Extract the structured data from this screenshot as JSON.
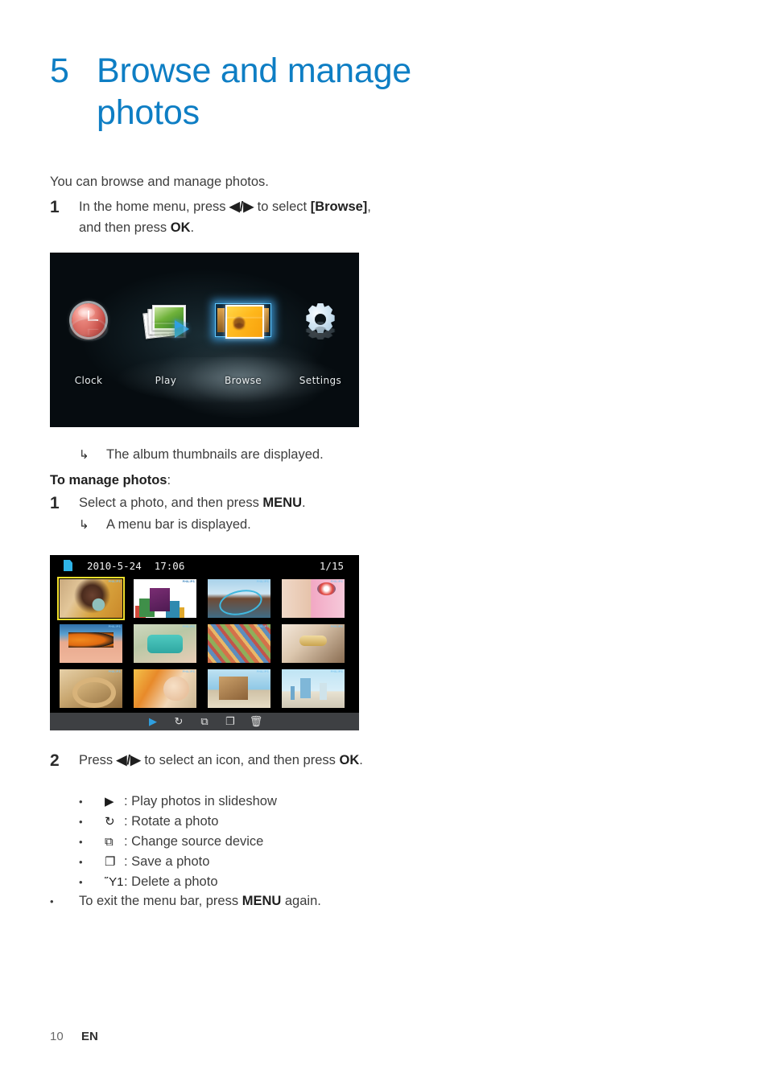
{
  "document": {
    "chapter_number": "5",
    "chapter_title": "Browse and manage photos",
    "intro": "You can browse and manage photos.",
    "footer": {
      "page_number": "10",
      "language": "EN"
    }
  },
  "steps": {
    "step1": {
      "number": "1",
      "text_part1": "In the home menu, press ",
      "nav_glyph": "◀/▶",
      "text_part2": " to select ",
      "bold_target": "[Browse]",
      "text_part3": ", and then press ",
      "bold_key": "OK",
      "text_part4": "."
    },
    "result_album": {
      "arrow": "↳",
      "text": "The album thumbnails are displayed."
    },
    "subheading": {
      "bold": "To manage photos",
      "colon": ":"
    },
    "manage_step1": {
      "number": "1",
      "text_part1": "Select a photo, and then press ",
      "bold_key": "MENU",
      "text_part2": "."
    },
    "result_menubar": {
      "arrow": "↳",
      "text": "A menu bar is displayed."
    },
    "step2": {
      "number": "2",
      "text_part1": "Press ",
      "nav_glyph": "◀/▶",
      "text_part2": " to select an icon, and then press ",
      "bold_key": "OK",
      "text_part3": "."
    },
    "icon_list": {
      "bullet": "•",
      "rows": [
        {
          "glyph": "▶",
          "icon_name": "play-icon",
          "text": ": Play photos in slideshow"
        },
        {
          "glyph": "↻",
          "icon_name": "rotate-icon",
          "text": ": Rotate a photo"
        },
        {
          "glyph": "⧉",
          "icon_name": "source-device-icon",
          "text": ": Change source device"
        },
        {
          "glyph": "❐",
          "icon_name": "save-icon",
          "text": ": Save a photo"
        },
        {
          "glyph": "Ὕ1",
          "icon_name": "trash-icon",
          "text": ": Delete a photo"
        }
      ]
    },
    "exit_line": {
      "bullet": "•",
      "text_part1": "To exit the menu bar, press ",
      "bold_key": "MENU",
      "text_part2": " again."
    }
  },
  "screenshot_home_menu": {
    "caption_items": [
      {
        "label": "Clock",
        "icon": "clock-icon",
        "selected": false
      },
      {
        "label": "Play",
        "icon": "play-photos-icon",
        "selected": false
      },
      {
        "label": "Browse",
        "icon": "browse-icon",
        "selected": true
      },
      {
        "label": "Settings",
        "icon": "gear-icon",
        "selected": false
      }
    ]
  },
  "screenshot_thumbnail_grid": {
    "topbar": {
      "file_icon": "file-icon",
      "date": "2010-5-24",
      "time": "17:06",
      "counter": "1/15"
    },
    "watermark": "PHILIPS",
    "thumbnails": [
      [
        {
          "name": "woman-drinking-coffee",
          "selected": true
        },
        {
          "name": "gift-boxes",
          "selected": false
        },
        {
          "name": "pool-party-hula-hoop",
          "selected": false
        },
        {
          "name": "woman-with-puppy",
          "selected": false
        }
      ],
      [
        {
          "name": "butterfly-on-hand",
          "selected": false
        },
        {
          "name": "girl-with-green-gloves",
          "selected": false
        },
        {
          "name": "crowd-festival",
          "selected": false
        },
        {
          "name": "carnival-masks",
          "selected": false
        }
      ],
      [
        {
          "name": "pretzels",
          "selected": false
        },
        {
          "name": "girl-in-sunlight",
          "selected": false
        },
        {
          "name": "stilt-house-beach",
          "selected": false
        },
        {
          "name": "children-on-beach",
          "selected": false
        }
      ]
    ],
    "menubar": [
      {
        "glyph": "▶",
        "name": "slideshow-icon",
        "active": true
      },
      {
        "glyph": "↻",
        "name": "rotate-icon",
        "active": false
      },
      {
        "glyph": "⧉",
        "name": "source-device-icon",
        "active": false
      },
      {
        "glyph": "❐",
        "name": "copy-save-icon",
        "active": false
      },
      {
        "glyph": "🗑",
        "name": "delete-icon",
        "active": false
      }
    ]
  },
  "colors": {
    "heading_blue": "#0e7ec4",
    "body_gray": "#3d3d3d",
    "selection_yellow": "#f3e02c",
    "menubar_gray": "#3e4043",
    "accent_cyan": "#2f9fe0"
  }
}
